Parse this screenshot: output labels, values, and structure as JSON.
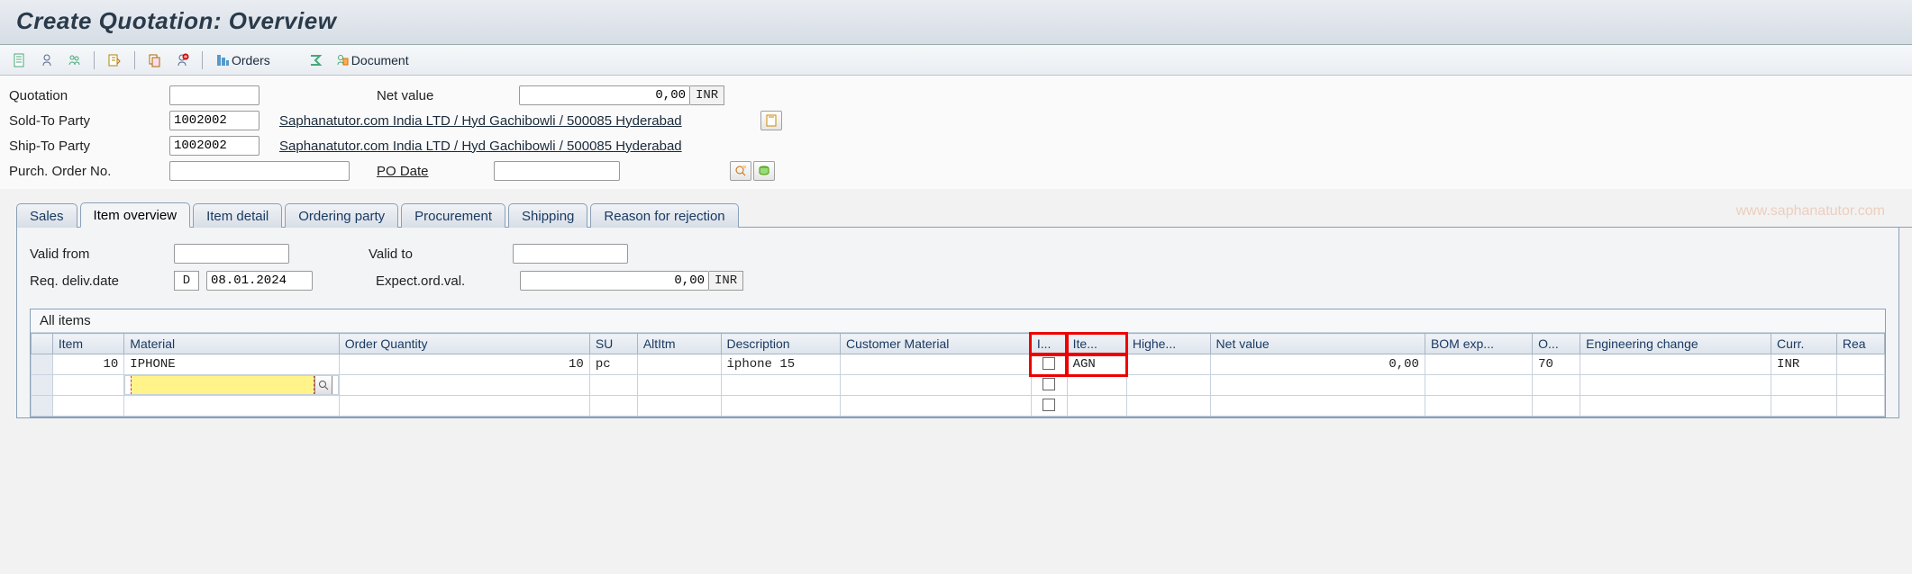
{
  "title": "Create Quotation: Overview",
  "toolbar": {
    "orders_label": "Orders",
    "document_label": "Document"
  },
  "header": {
    "quotation_label": "Quotation",
    "quotation_value": "",
    "net_value_label": "Net value",
    "net_value_value": "0,00",
    "currency": "INR",
    "sold_to_label": "Sold-To Party",
    "sold_to_value": "1002002",
    "sold_to_desc": "Saphanatutor.com India LTD / Hyd Gachibowli / 500085 Hyderabad",
    "ship_to_label": "Ship-To Party",
    "ship_to_value": "1002002",
    "ship_to_desc": "Saphanatutor.com India LTD / Hyd Gachibowli / 500085 Hyderabad",
    "po_label": "Purch. Order No.",
    "po_value": "",
    "po_date_label": "PO Date",
    "po_date_value": ""
  },
  "tabs": [
    "Sales",
    "Item overview",
    "Item detail",
    "Ordering party",
    "Procurement",
    "Shipping",
    "Reason for rejection"
  ],
  "panel": {
    "valid_from_label": "Valid from",
    "valid_from_value": "",
    "valid_to_label": "Valid to",
    "valid_to_value": "",
    "req_deliv_label": "Req. deliv.date",
    "req_deliv_type": "D",
    "req_deliv_value": "08.01.2024",
    "expect_label": "Expect.ord.val.",
    "expect_value": "0,00",
    "expect_curr": "INR"
  },
  "grid": {
    "title": "All items",
    "columns": [
      "Item",
      "Material",
      "Order Quantity",
      "SU",
      "AltItm",
      "Description",
      "Customer Material",
      "I...",
      "Ite...",
      "Highe...",
      "Net value",
      "BOM exp...",
      "O...",
      "Engineering change",
      "Curr.",
      "Rea"
    ],
    "rows": [
      {
        "item": "10",
        "material": "IPHONE",
        "qty": "10",
        "su": "pc",
        "altitm": "",
        "desc": "iphone 15",
        "custmat": "",
        "ite": "AGN",
        "netval": "0,00",
        "o": "70",
        "curr": "INR"
      }
    ]
  },
  "watermark": "www.saphanatutor.com"
}
